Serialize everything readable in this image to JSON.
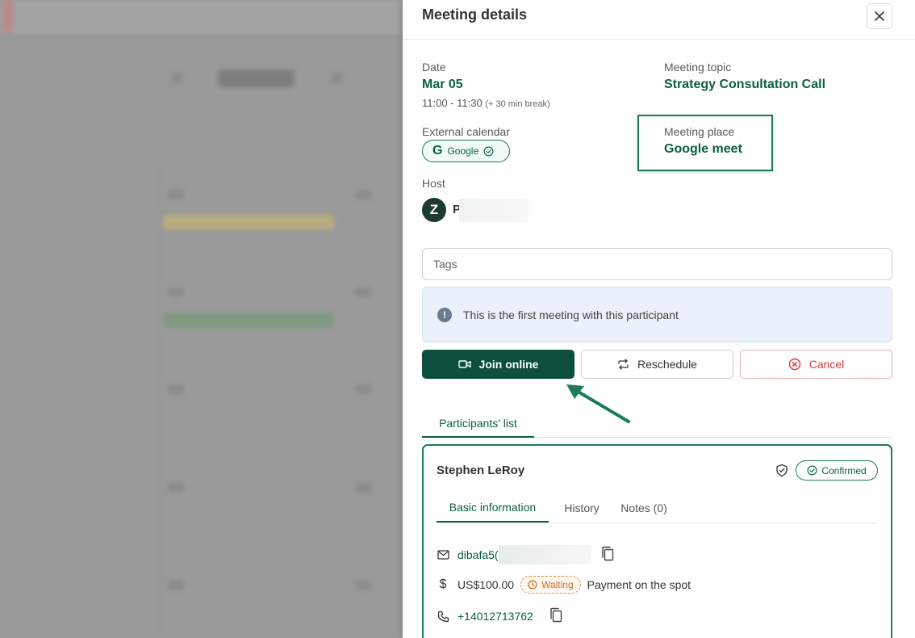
{
  "panel": {
    "title": "Meeting details"
  },
  "details": {
    "date_label": "Date",
    "date_value": "Mar 05",
    "time_value": "11:00 - 11:30",
    "break_note": "(+ 30 min break)",
    "topic_label": "Meeting topic",
    "topic_value": "Strategy Consultation Call",
    "ext_calendar_label": "External calendar",
    "ext_calendar_value": "Google",
    "place_label": "Meeting place",
    "place_value": "Google meet",
    "host_label": "Host",
    "host_name": "P",
    "host_avatar_letter": "Z"
  },
  "tags": {
    "placeholder": "Tags"
  },
  "info": {
    "message": "This is the first meeting with this participant"
  },
  "actions": {
    "join_label": "Join online",
    "reschedule_label": "Reschedule",
    "cancel_label": "Cancel"
  },
  "tabs": {
    "participants_label": "Participants' list"
  },
  "participant": {
    "name": "Stephen LeRoy",
    "status": "Confirmed",
    "tabs": {
      "basic": "Basic information",
      "history": "History",
      "notes": "Notes (0)"
    },
    "email": "dibafa5(",
    "price": "US$100.00",
    "payment_status": "Waiting",
    "payment_note": "Payment on the spot",
    "phone": "+14012713762"
  },
  "colors": {
    "brand": "#0b4f3c",
    "accent": "#1d7a5a",
    "danger": "#d63a3a",
    "warning": "#e08a3a"
  }
}
